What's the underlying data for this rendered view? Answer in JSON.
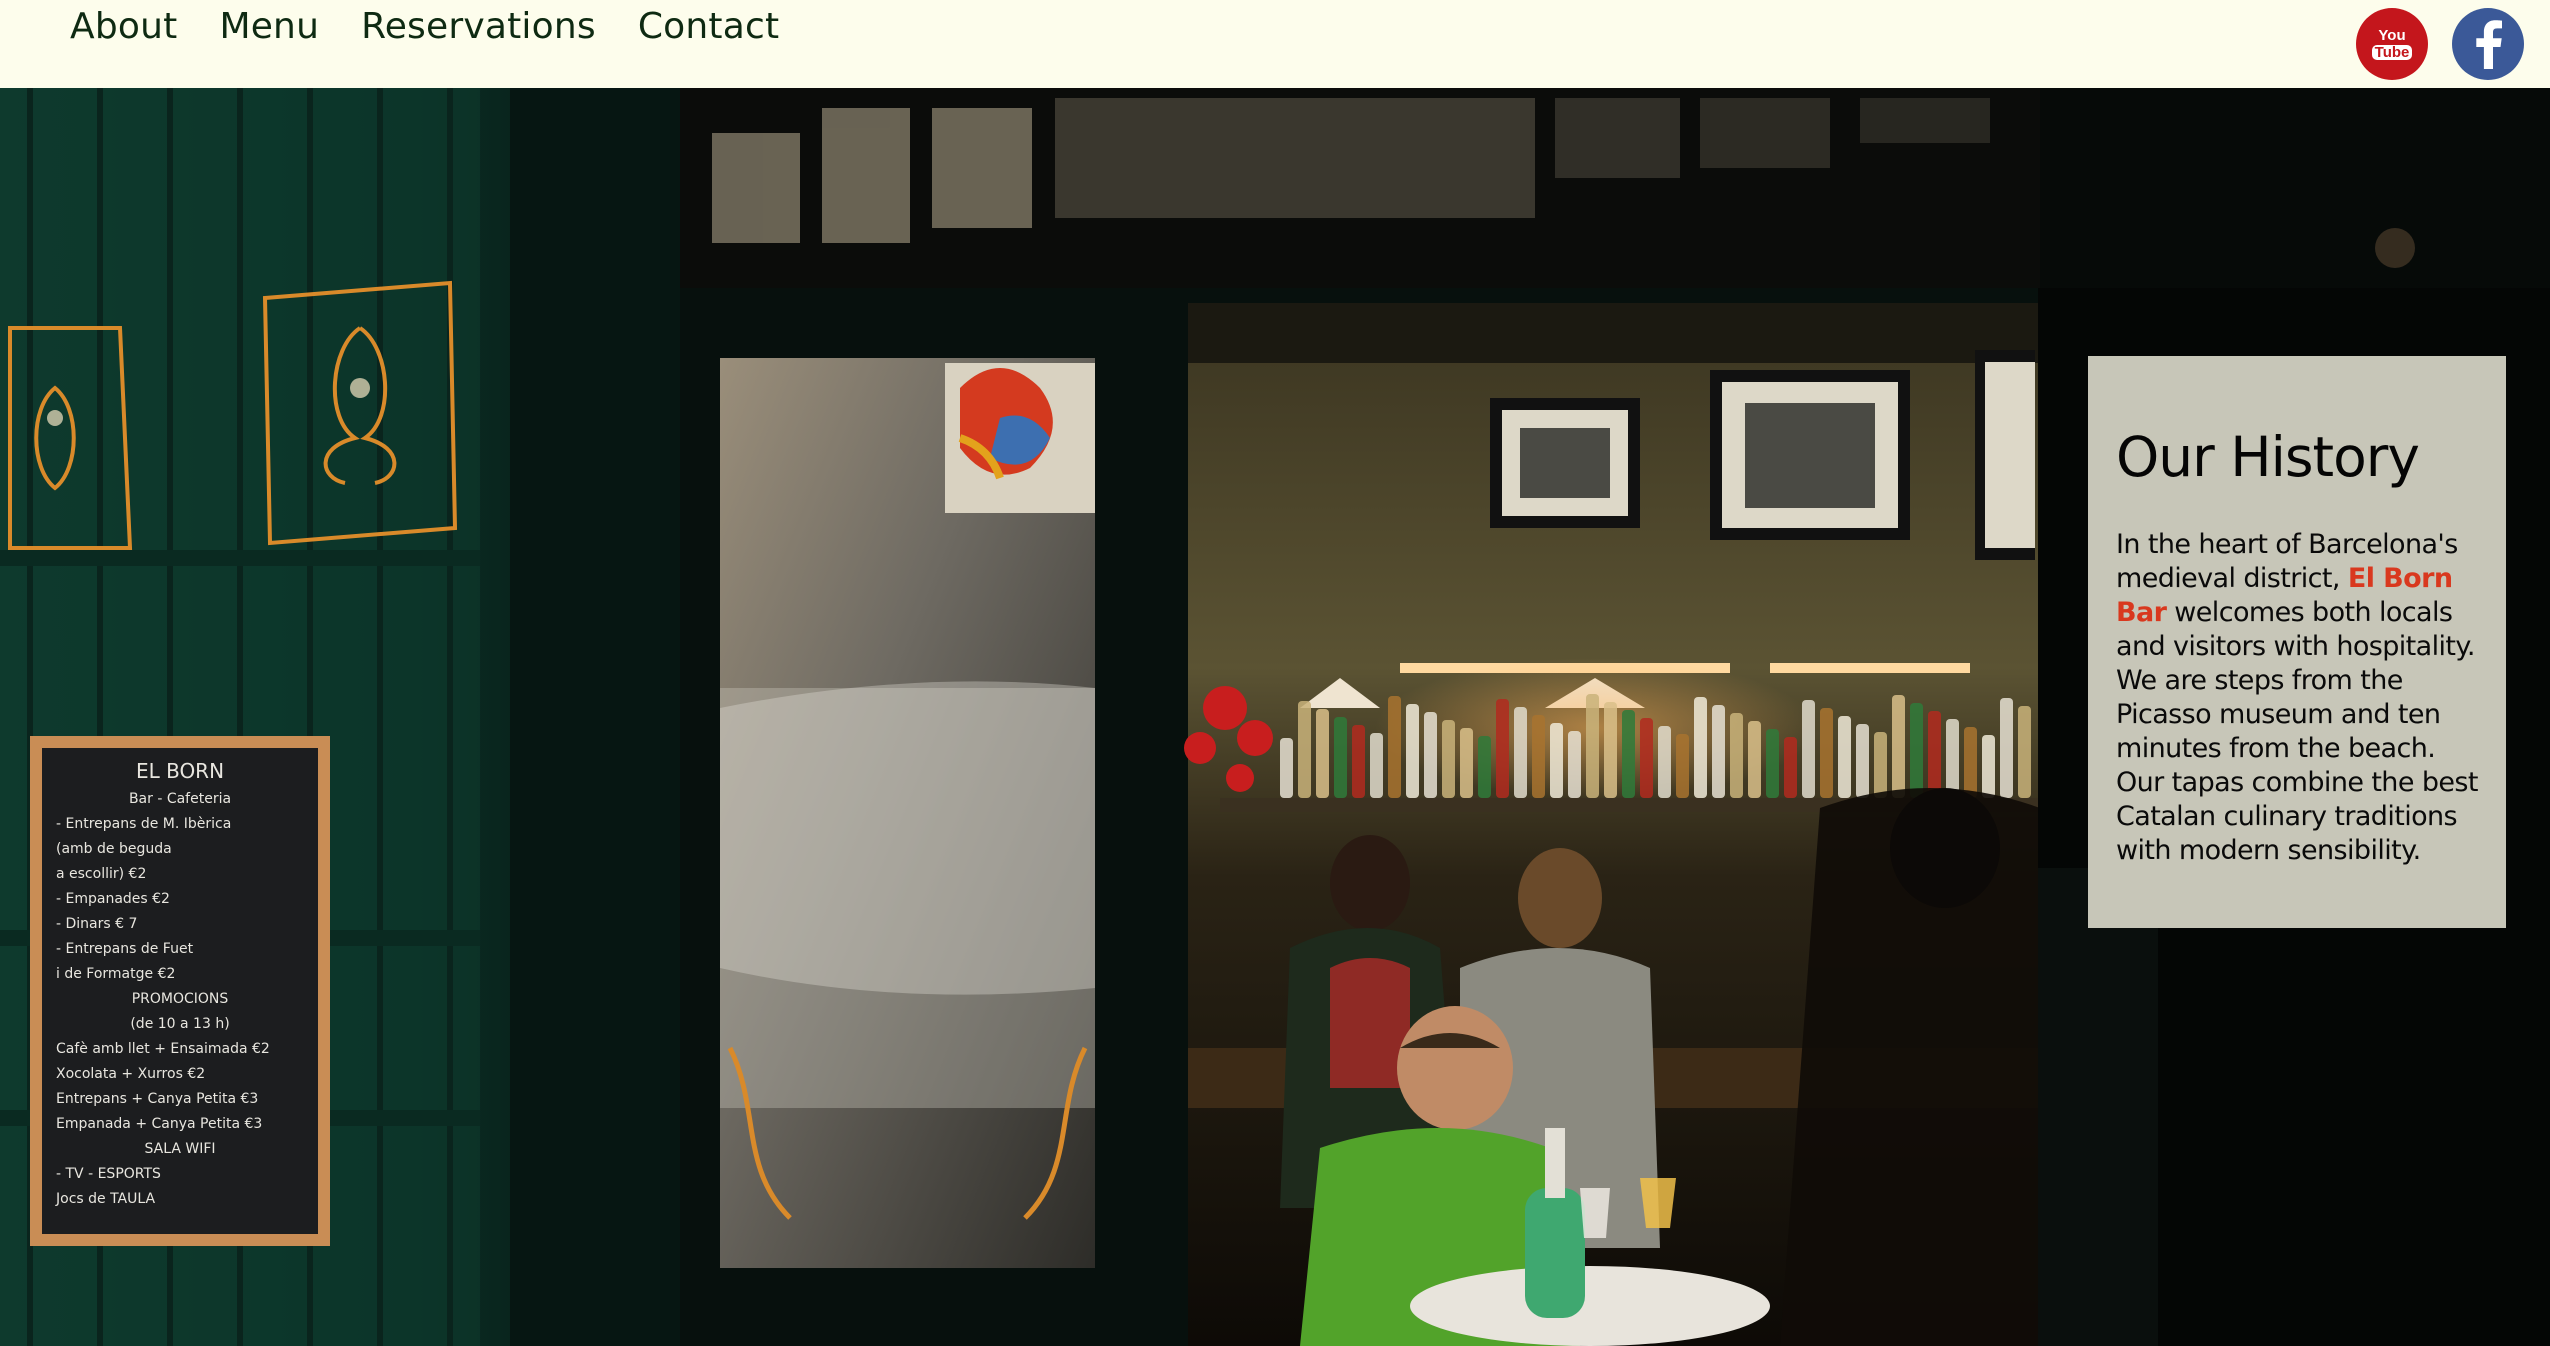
{
  "nav": {
    "items": [
      {
        "label": "About"
      },
      {
        "label": "Menu"
      },
      {
        "label": "Reservations"
      },
      {
        "label": "Contact"
      }
    ]
  },
  "social": {
    "youtube": {
      "icon": "youtube-icon",
      "line1": "You",
      "line2": "Tube",
      "color": "#c4161c"
    },
    "facebook": {
      "icon": "facebook-icon",
      "glyph": "f",
      "color": "#3b5998"
    }
  },
  "hero": {
    "chalkboard": {
      "lines": [
        "EL BORN",
        "Bar - Cafeteria",
        "- Entrepans de M. Ibèrica",
        "(amb de beguda",
        "a escollir) €2",
        "- Empanades €2",
        "- Dinars € 7",
        "- Entrepans de Fuet",
        "i de Formatge €2",
        "PROMOCIONS",
        "(de 10 a 13 h)",
        "Cafè amb llet + Ensaimada €2",
        "Xocolata + Xurros €2",
        "Entrepans + Canya Petita €3",
        "Empanada + Canya Petita €3",
        "SALA WIFI",
        "- TV - ESPORTS",
        "Jocs de TAULA"
      ]
    }
  },
  "history": {
    "title": "Our History",
    "text_before": "In the heart of Barcelona's medieval district, ",
    "highlight": "El Born Bar",
    "text_after": " welcomes both locals and visitors with hospitality. We are steps from the Picasso museum and ten minutes from the beach. Our tapas combine the best Catalan culinary traditions with modern sensibility.",
    "highlight_color": "#d9381e",
    "panel_color": "#c7c6b8"
  }
}
